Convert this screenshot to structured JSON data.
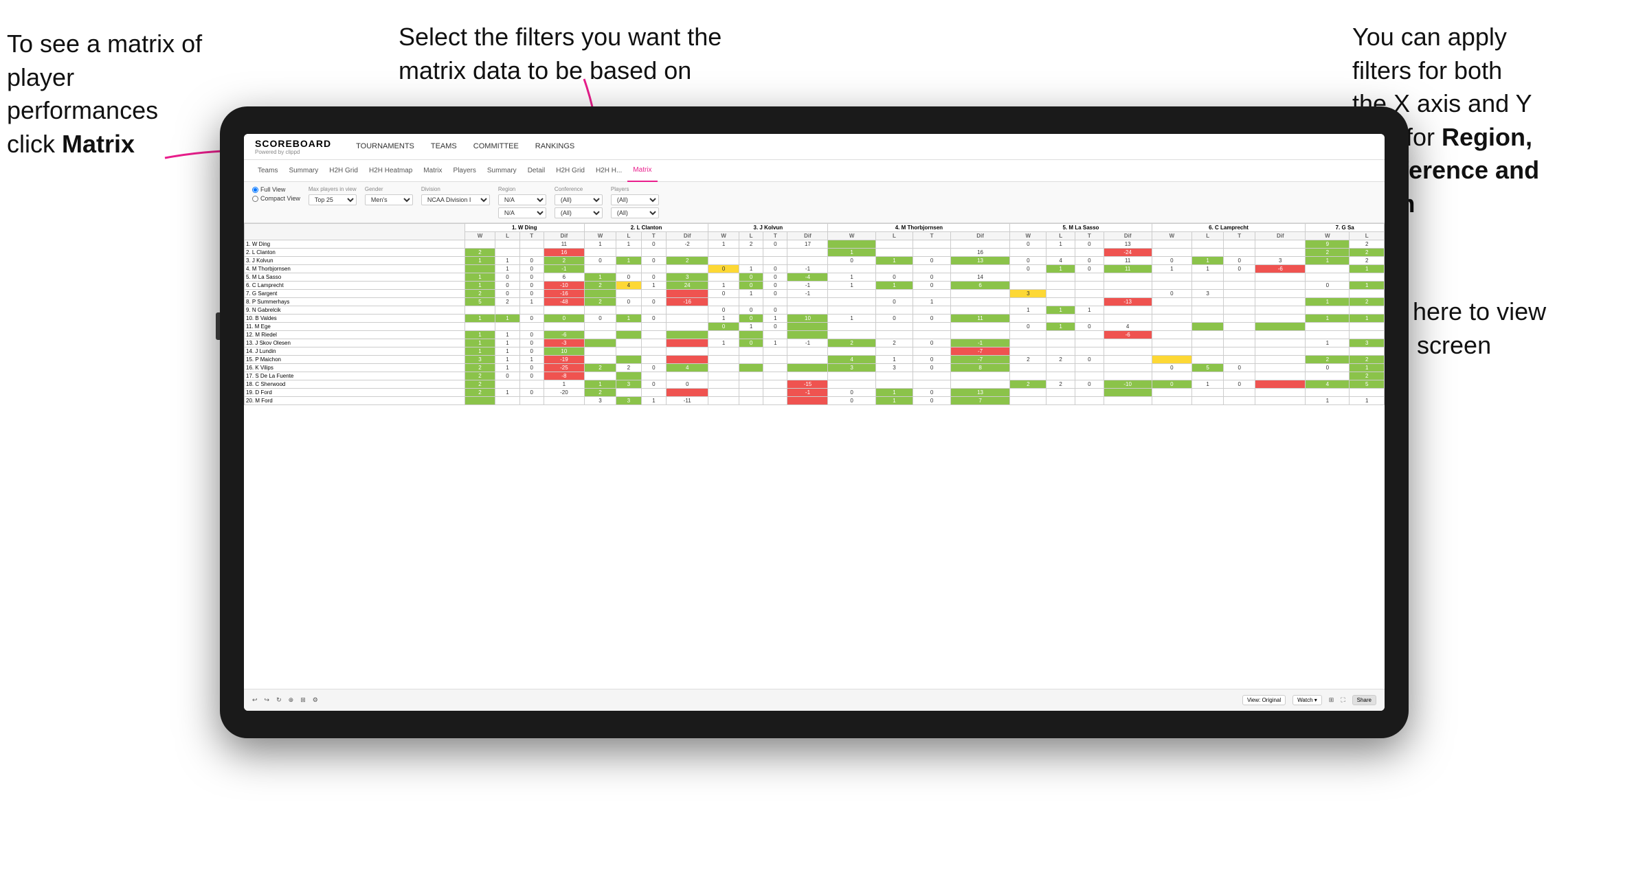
{
  "annotations": {
    "left": {
      "line1": "To see a matrix of",
      "line2": "player performances",
      "line3": "click ",
      "line3_bold": "Matrix"
    },
    "center": {
      "text": "Select the filters you want the matrix data to be based on"
    },
    "right": {
      "line1": "You  can apply",
      "line2": "filters for both",
      "line3": "the X axis and Y",
      "line4_pre": "Axis for ",
      "line4_bold": "Region,",
      "line5_bold": "Conference and",
      "line6_bold": "Team"
    },
    "bottom_right": {
      "line1": "Click here to view",
      "line2": "in full screen"
    }
  },
  "app": {
    "logo": "SCOREBOARD",
    "logo_sub": "Powered by clippd",
    "nav_items": [
      "TOURNAMENTS",
      "TEAMS",
      "COMMITTEE",
      "RANKINGS"
    ],
    "sub_nav": [
      "Teams",
      "Summary",
      "H2H Grid",
      "H2H Heatmap",
      "Matrix",
      "Players",
      "Summary",
      "Detail",
      "H2H Grid",
      "H2H H...",
      "Matrix"
    ],
    "active_tab": "Matrix"
  },
  "filters": {
    "view_options": [
      "Full View",
      "Compact View"
    ],
    "max_players_label": "Max players in view",
    "max_players_value": "Top 25",
    "gender_label": "Gender",
    "gender_value": "Men's",
    "division_label": "Division",
    "division_value": "NCAA Division I",
    "region_label": "Region",
    "region_value1": "N/A",
    "region_value2": "N/A",
    "conference_label": "Conference",
    "conference_value1": "(All)",
    "conference_value2": "(All)",
    "players_label": "Players",
    "players_value1": "(All)",
    "players_value2": "(All)"
  },
  "matrix_players": [
    "1. W Ding",
    "2. L Clanton",
    "3. J Kolvun",
    "4. M Thorbjornsen",
    "5. M La Sasso",
    "6. C Lamprecht",
    "7. G Sargent",
    "8. P Summerhays",
    "9. N Gabrelcik",
    "10. B Valdes",
    "11. M Ege",
    "12. M Riedel",
    "13. J Skov Olesen",
    "14. J Lundin",
    "15. P Maichon",
    "16. K Vilips",
    "17. S De La Fuente",
    "18. C Sherwood",
    "19. D Ford",
    "20. M Ford"
  ],
  "column_headers": [
    "1. W Ding",
    "2. L Clanton",
    "3. J Kolvun",
    "4. M Thorbjornsen",
    "5. M La Sasso",
    "6. C Lamprecht",
    "7. G Sa"
  ],
  "sub_headers": [
    "W",
    "L",
    "T",
    "Dif"
  ],
  "toolbar": {
    "view_original": "View: Original",
    "watch": "Watch ▾",
    "share": "Share"
  }
}
